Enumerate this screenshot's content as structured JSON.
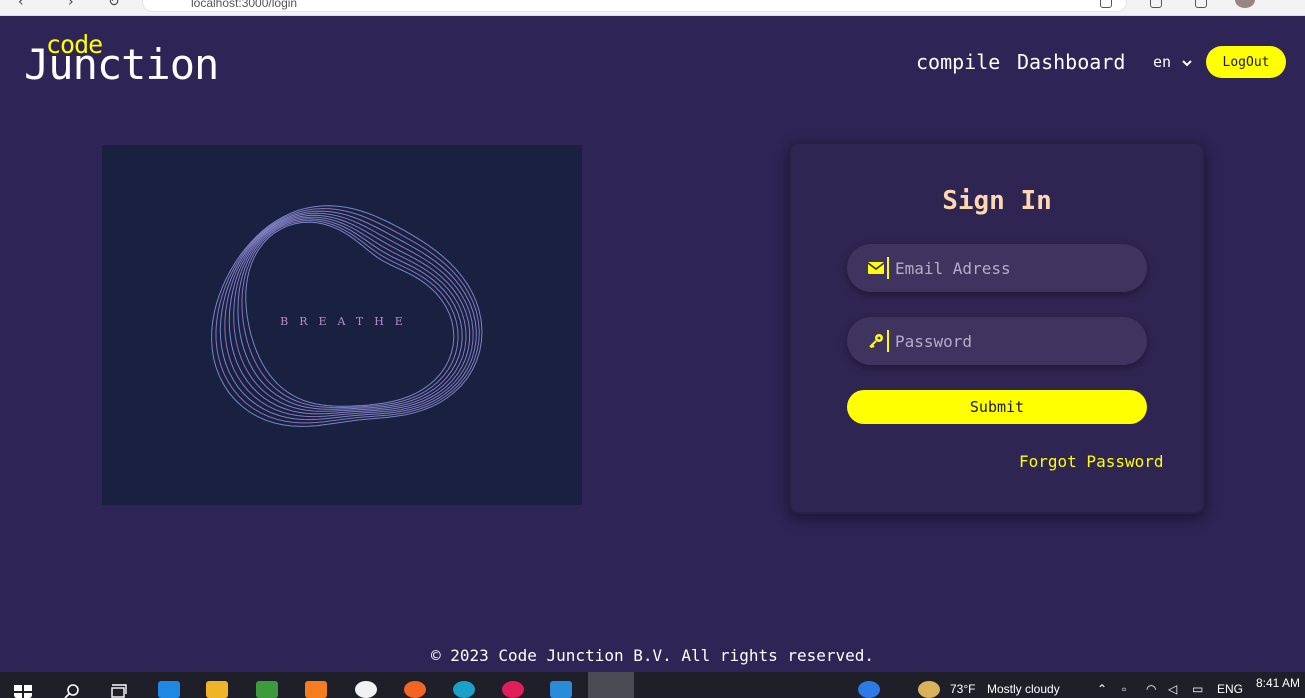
{
  "browser": {
    "address_text": "localhost:3000/login"
  },
  "header": {
    "logo_top": "code",
    "logo_main": "Junction",
    "nav": [
      {
        "label": "compile"
      },
      {
        "label": "Dashboard"
      }
    ],
    "language": "en",
    "logout_label": "LogOut"
  },
  "hero": {
    "word": "BREATHE"
  },
  "signin": {
    "title": "Sign In",
    "email_placeholder": "Email Adress",
    "password_placeholder": "Password",
    "submit_label": "Submit",
    "forgot_label": "Forgot Password"
  },
  "footer": {
    "text": "© 2023 Code Junction B.V. All rights reserved."
  },
  "taskbar": {
    "weather_temp": "73°F",
    "weather_desc": "Mostly cloudy",
    "lang": "ENG",
    "time": "8:41 AM"
  },
  "colors": {
    "background": "#2e2456",
    "accent": "#ffff00",
    "card_title": "#ffd8b0",
    "hero_bg": "#1a2140"
  }
}
